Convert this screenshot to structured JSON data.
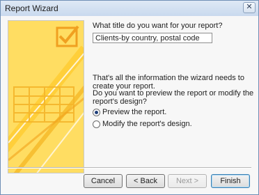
{
  "window": {
    "title": "Report Wizard",
    "close_glyph": "✕"
  },
  "prompt_label": "What title do you want for your report?",
  "title_field": {
    "value": "Clients-by country, postal code"
  },
  "info_text": "That's all the information the wizard needs to create your report.",
  "question_text": "Do you want to preview the report or modify the report's design?",
  "options": [
    {
      "label": "Preview the report.",
      "checked": true
    },
    {
      "label": "Modify the report's design.",
      "checked": false
    }
  ],
  "buttons": {
    "cancel": "Cancel",
    "back": "< Back",
    "next": "Next >",
    "finish": "Finish"
  },
  "colors": {
    "art_background": "#ffd84d",
    "art_accent": "#f2a31c"
  }
}
